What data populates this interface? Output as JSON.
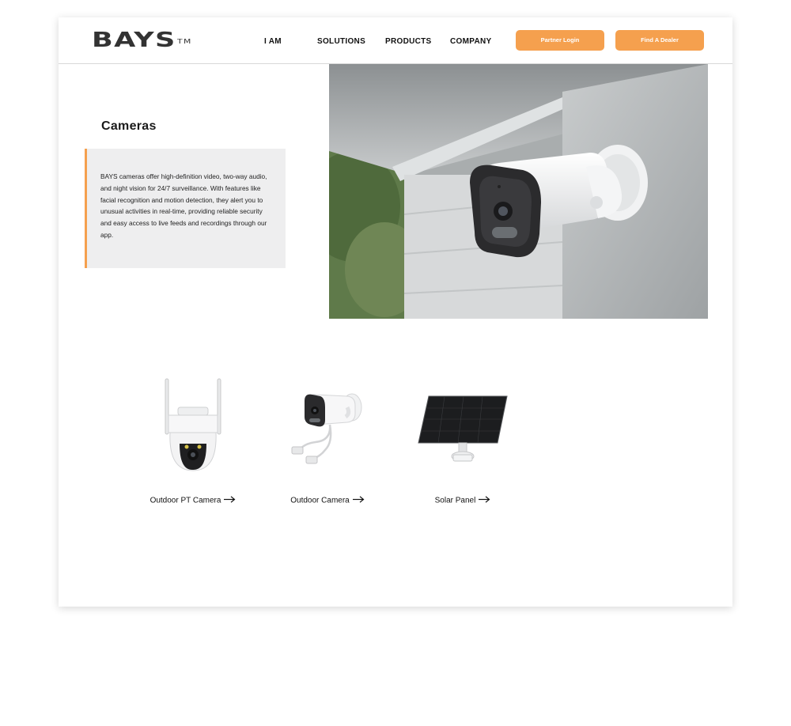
{
  "brand": {
    "name": "BAYS",
    "trademark": "TM"
  },
  "nav": {
    "items": [
      {
        "label": "I AM"
      },
      {
        "label": "SOLUTIONS"
      },
      {
        "label": "PRODUCTS"
      },
      {
        "label": "COMPANY"
      }
    ],
    "partner_login": "Partner Login",
    "find_dealer": "Find A Dealer"
  },
  "hero": {
    "title": "Cameras",
    "description": "BAYS cameras offer high-definition video, two-way audio, and night vision for 24/7 surveillance. With features like facial recognition and motion detection, they alert you to unusual activities in real-time, providing reliable security and easy access to live feeds and recordings through our app."
  },
  "products": [
    {
      "label": "Outdoor PT Camera",
      "icon": "arrow-right-icon"
    },
    {
      "label": "Outdoor Camera",
      "icon": "arrow-right-icon"
    },
    {
      "label": "Solar Panel",
      "icon": "arrow-right-icon"
    }
  ],
  "colors": {
    "accent": "#f5a04e",
    "text": "#111111",
    "panel": "#eeeeef"
  }
}
